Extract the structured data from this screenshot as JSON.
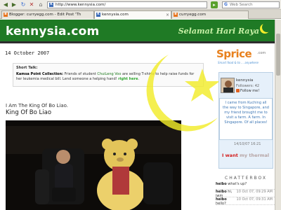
{
  "browser": {
    "url": "http://www.kennysia.com/",
    "search_placeholder": "Web Search",
    "search_engine_glyph": "G",
    "tabs": [
      {
        "label": "Blogger: curryegg.com - Edit Post 'Th",
        "icon": "blogger-icon"
      },
      {
        "label": "kennysia.com",
        "icon": "kennysia-icon"
      },
      {
        "label": "curryegg.com",
        "icon": "blogger-icon"
      }
    ],
    "favicon_letter": "K",
    "tab_close_glyph": "×",
    "accent_color": "#5aa02c"
  },
  "header": {
    "site_name": "kennysia.com",
    "greeting": "Selamat Hari Raya",
    "bg_color": "#1f7a25"
  },
  "post": {
    "date": "14 October 2007",
    "short_talk": {
      "title": "Short Talk:",
      "label": "Kamsa Point Collection:",
      "text_a": " Friends of student ",
      "link_name": "ChuiLeng Voo",
      "text_b": " are selling T-shirts to help raise funds for her ",
      "text_c": "leukemia medical bill. Lend someone a helping hand! ",
      "more": "right here",
      "end": "."
    },
    "title": "King Of Bo Liao",
    "body": "I Am The King Of Bo Liao."
  },
  "sidebar": {
    "sprice": {
      "word": "Sprice",
      "suffix": ".com",
      "tagline": "Smart food & to ... anywhere"
    },
    "profile": {
      "name": "kennysia",
      "followers": "Followers: 42",
      "follow_label": "Follow me!"
    },
    "status": "I came from Kuching all the way to Singapore, and my friend brought me to visit a farm. A farm. In Singapore. Of all places!",
    "status_time": "14/10/07 16:21",
    "i_want_prefix": "I want ",
    "i_want_strike": "my thermal",
    "chatterbox_title": "CHATTERBOX",
    "chats": [
      {
        "name": "heibo",
        "message": "what's up?",
        "time": ""
      },
      {
        "name": "heibo",
        "message": "hi, iwm",
        "time": "10 Oct 07, 09:29 AM"
      },
      {
        "name": "heibo",
        "message": "hello?",
        "time": "10 Oct 07, 09:31 AM"
      }
    ]
  }
}
